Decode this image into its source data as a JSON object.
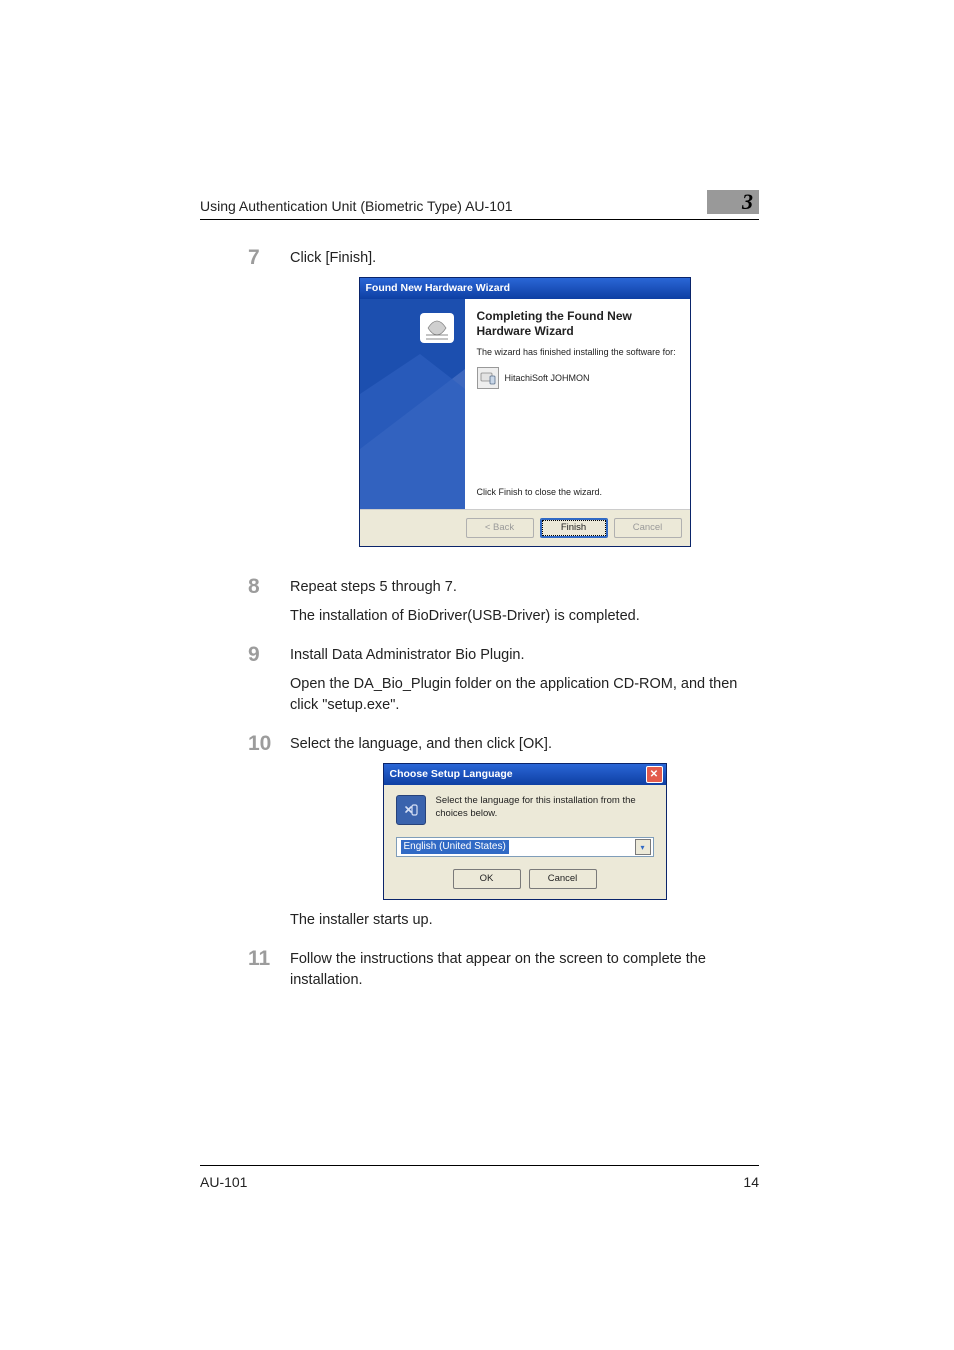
{
  "header": {
    "running_title": "Using Authentication Unit (Biometric Type) AU-101",
    "chapter_number": "3"
  },
  "steps": {
    "s7": {
      "num": "7",
      "p1": "Click [Finish]."
    },
    "s8": {
      "num": "8",
      "p1": "Repeat steps 5 through 7.",
      "p2": "The installation of BioDriver(USB-Driver) is completed."
    },
    "s9": {
      "num": "9",
      "p1": "Install Data Administrator Bio Plugin.",
      "p2": "Open the DA_Bio_Plugin folder on the application CD-ROM, and then click \"setup.exe\"."
    },
    "s10": {
      "num": "10",
      "p1": "Select the language, and then click [OK].",
      "after": "The installer starts up."
    },
    "s11": {
      "num": "11",
      "p1": "Follow the instructions that appear on the screen to complete the installation."
    }
  },
  "hw_wizard": {
    "title": "Found New Hardware Wizard",
    "heading": "Completing the Found New Hardware Wizard",
    "subtext": "The wizard has finished installing the software for:",
    "device": "HitachiSoft JOHMON",
    "close_hint": "Click Finish to close the wizard.",
    "btn_back": "< Back",
    "btn_finish": "Finish",
    "btn_cancel": "Cancel"
  },
  "lang_dialog": {
    "title": "Choose Setup Language",
    "close_glyph": "✕",
    "prompt": "Select the language for this installation from the choices below.",
    "selected": "English (United States)",
    "dropdown_glyph": "▾",
    "btn_ok": "OK",
    "btn_cancel": "Cancel"
  },
  "footer": {
    "left": "AU-101",
    "right": "14"
  }
}
